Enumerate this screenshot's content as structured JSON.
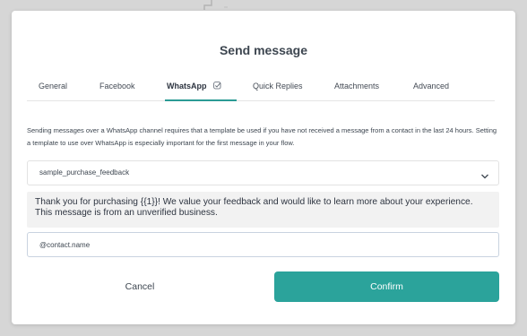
{
  "dialog": {
    "title": "Send message"
  },
  "tabs": [
    {
      "label": "General",
      "active": false
    },
    {
      "label": "Facebook",
      "active": false
    },
    {
      "label": "WhatsApp",
      "active": true,
      "icon": "check-icon"
    },
    {
      "label": "Quick Replies",
      "active": false
    },
    {
      "label": "Attachments",
      "active": false
    },
    {
      "label": "Advanced",
      "active": false
    }
  ],
  "whatsapp": {
    "description": "Sending messages over a WhatsApp channel requires that a template be used if you have not received a message from a contact in the last 24 hours. Setting a template to use over WhatsApp is especially important for the first message in your flow.",
    "template_select": {
      "value": "sample_purchase_feedback",
      "icon": "chevron-down-icon"
    },
    "template_text": "Thank you for purchasing {{1}}! We value your feedback and would like to learn more about your experience. This message is from an unverified business.",
    "param_input": {
      "value": "@contact.name"
    }
  },
  "footer": {
    "cancel_label": "Cancel",
    "confirm_label": "Confirm"
  },
  "colors": {
    "accent": "#2ba39b",
    "backdrop": "#d6d6d6"
  }
}
